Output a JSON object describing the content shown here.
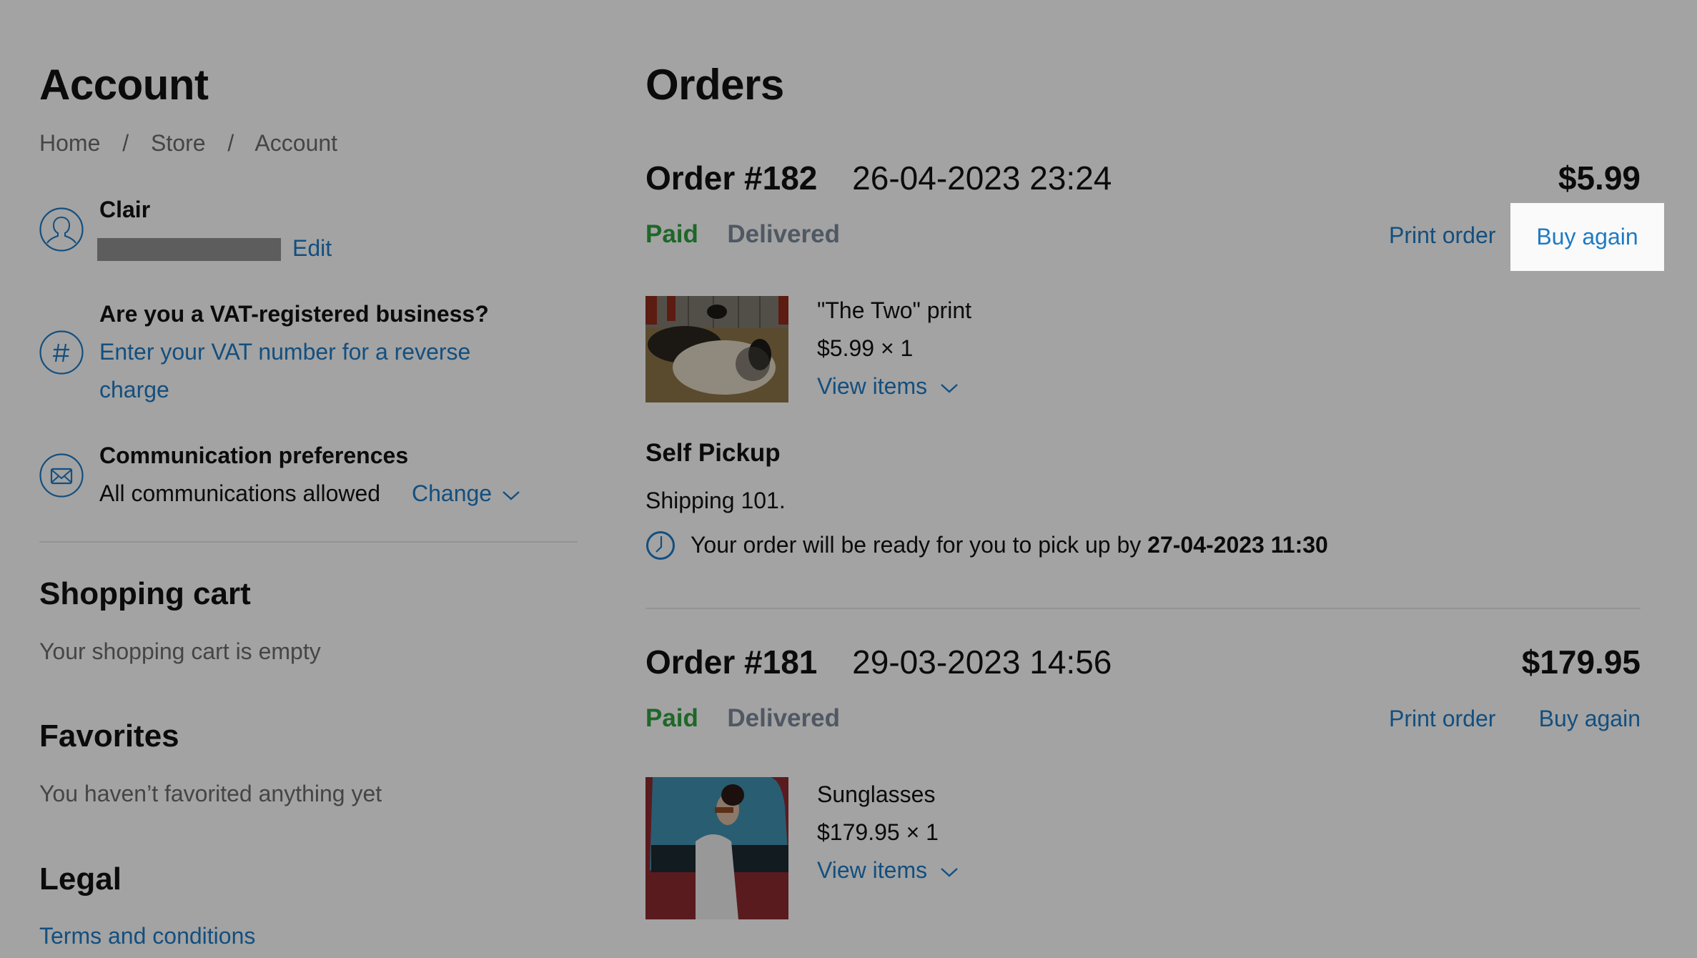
{
  "colors": {
    "link": "#1e7ac4",
    "paid": "#2e9e3e",
    "delivered": "#7a8898",
    "overlay_background": "#a6a6a6",
    "highlight": "#fafafa"
  },
  "account": {
    "title": "Account",
    "breadcrumb": [
      "Home",
      "Store",
      "Account"
    ],
    "breadcrumb_separator": "/",
    "user": {
      "icon": "user-icon",
      "name": "Clair",
      "email_redacted": true,
      "edit_label": "Edit"
    },
    "vat": {
      "icon": "hash-icon",
      "title": "Are you a VAT-registered business?",
      "link_line1": "Enter your VAT number for a reverse",
      "link_line2": "charge"
    },
    "communication": {
      "icon": "envelope-icon",
      "title": "Communication preferences",
      "status": "All communications allowed",
      "change_label": "Change"
    },
    "shopping_cart": {
      "title": "Shopping cart",
      "empty_text": "Your shopping cart is empty"
    },
    "favorites": {
      "title": "Favorites",
      "empty_text": "You haven’t favorited anything yet"
    },
    "legal": {
      "title": "Legal",
      "links": [
        "Terms and conditions"
      ]
    }
  },
  "orders": {
    "title": "Orders",
    "list": [
      {
        "number": "Order #182",
        "date": "26-04-2023 23:24",
        "total": "$5.99",
        "payment_status": "Paid",
        "fulfillment_status": "Delivered",
        "print_label": "Print order",
        "buy_again_label": "Buy again",
        "buy_again_highlighted": true,
        "item": {
          "image": "sheep-photo",
          "name": "\"The Two\" print",
          "price_qty": "$5.99 × 1",
          "view_items_label": "View items"
        },
        "delivery": {
          "method": "Self Pickup",
          "location": "Shipping 101.",
          "ready_prefix": "Your order will be ready for you to pick up by",
          "ready_time": "27-04-2023 11:30"
        }
      },
      {
        "number": "Order #181",
        "date": "29-03-2023 14:56",
        "total": "$179.95",
        "payment_status": "Paid",
        "fulfillment_status": "Delivered",
        "print_label": "Print order",
        "buy_again_label": "Buy again",
        "buy_again_highlighted": false,
        "item": {
          "image": "sunglasses-model-photo",
          "name": "Sunglasses",
          "price_qty": "$179.95 × 1",
          "view_items_label": "View items"
        }
      }
    ]
  }
}
